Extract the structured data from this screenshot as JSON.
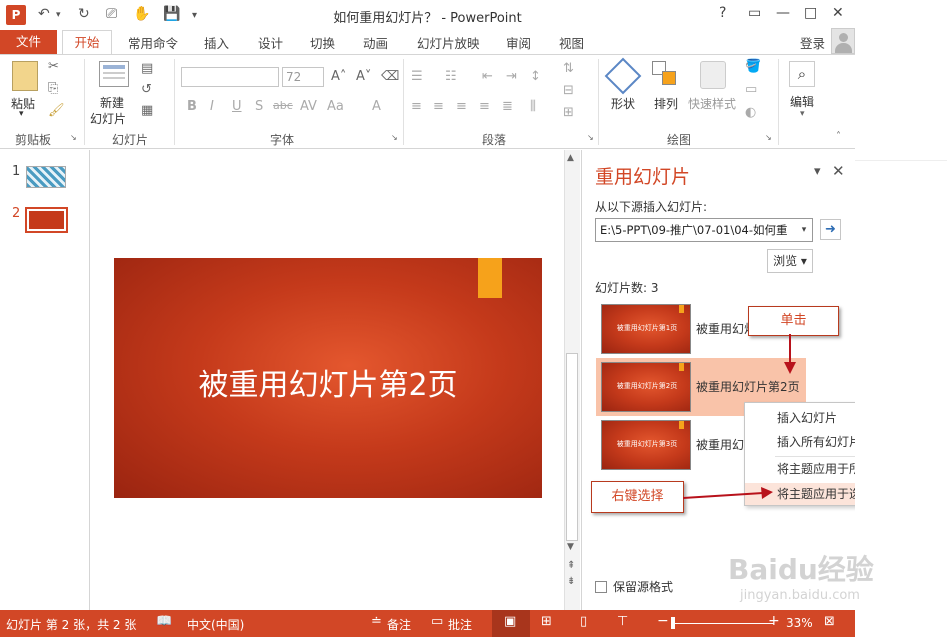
{
  "window": {
    "title": "如何重用幻灯片？ - PowerPoint",
    "help": "?",
    "restore": "▭",
    "minimize": "—",
    "maximize": "□",
    "close": "✕"
  },
  "quick_access": {
    "undo": "↶",
    "redo": "↻",
    "save": "💾",
    "customize": "▾"
  },
  "ribbon_tabs": {
    "file": "文件",
    "home": "开始",
    "items": [
      "常用命令",
      "插入",
      "设计",
      "切换",
      "动画",
      "幻灯片放映",
      "审阅",
      "视图"
    ],
    "login": "登录"
  },
  "ribbon": {
    "clipboard": {
      "paste": "粘贴",
      "group": "剪贴板"
    },
    "slides": {
      "new_slide_1": "新建",
      "new_slide_2": "幻灯片",
      "group": "幻灯片"
    },
    "font": {
      "size": "72",
      "bold": "B",
      "italic": "I",
      "underline": "U",
      "shadow": "S",
      "strike": "abc",
      "group": "字体"
    },
    "paragraph": {
      "group": "段落"
    },
    "drawing": {
      "shapes": "形状",
      "arrange": "排列",
      "quick_styles": "快速样式",
      "group": "绘图"
    },
    "editing": {
      "label": "编辑"
    }
  },
  "thumbnails": [
    "1",
    "2"
  ],
  "slide": {
    "title": "被重用幻灯片第2页"
  },
  "reuse_pane": {
    "title": "重用幻灯片",
    "source_label": "从以下源插入幻灯片:",
    "path": "E:\\5-PPT\\09-推广\\07-01\\04-如何重",
    "go": "➜",
    "browse": "浏览",
    "count": "幻灯片数: 3",
    "items": [
      {
        "name": "被重用幻灯",
        "thumb": "被重用幻灯片第1页"
      },
      {
        "name": "被重用幻灯片第2页",
        "thumb": "被重用幻灯片第2页"
      },
      {
        "name": "被重用幻灯",
        "thumb": "被重用幻灯片第3页"
      }
    ],
    "keep_format": "保留源格式"
  },
  "callouts": {
    "click": "单击",
    "right_click": "右键选择"
  },
  "context_menu": [
    "插入幻灯片",
    "插入所有幻灯片",
    "将主题应用于所有幻灯片",
    "将主题应用于选定的幻灯片"
  ],
  "statusbar": {
    "slide_info": "幻灯片 第 2 张，共 2 张",
    "language": "中文(中国)",
    "notes": "备注",
    "comments": "批注",
    "zoom": "33%"
  },
  "watermark": {
    "brand": "Baidu经验",
    "url": "jingyan.baidu.com"
  },
  "colors": {
    "accent": "#d24726",
    "selected": "#f9c3a9",
    "slide_bg": "#c53a1b",
    "slide_tag": "#f6a21b"
  }
}
